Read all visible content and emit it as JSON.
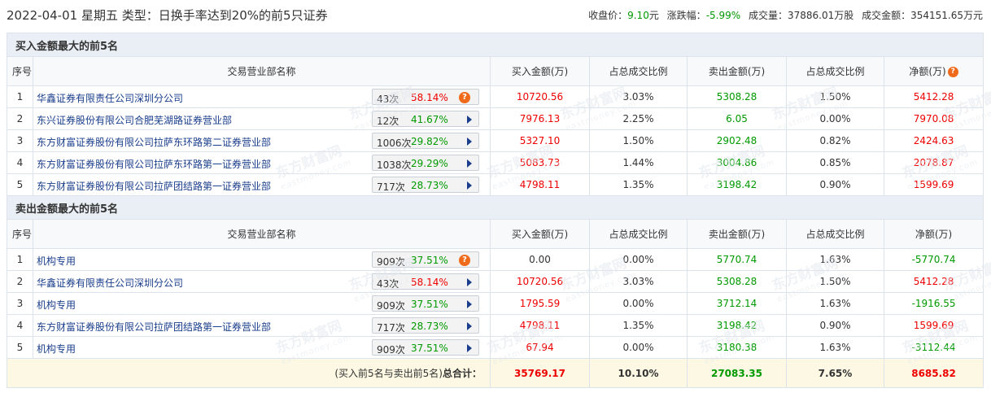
{
  "header": {
    "title": "2022-04-01 星期五 类型：日换手率达到20%的前5只证券",
    "close_label": "收盘价：",
    "close_value": "9.10",
    "close_unit": "元",
    "change_label": "涨跌幅：",
    "change_value": "-5.99%",
    "volume_label": "成交量：",
    "volume_value": "37886.01万股",
    "amount_label": "成交金额：",
    "amount_value": "354151.65万元"
  },
  "buy_section": {
    "title": "买入金额最大的前5名",
    "columns": [
      "序号",
      "交易营业部名称",
      "买入金额(万)",
      "占总成交比例",
      "卖出金额(万)",
      "占总成交比例",
      "净额(万)"
    ],
    "rows": [
      {
        "idx": "1",
        "name": "华鑫证券有限责任公司深圳分公司",
        "count": "43次",
        "pct": "58.14%",
        "pct_color": "red",
        "buy": "10720.56",
        "buy_ratio": "3.03%",
        "sell": "5308.28",
        "sell_ratio": "1.50%",
        "net": "5412.28",
        "net_color": "red",
        "icon": "qmark"
      },
      {
        "idx": "2",
        "name": "东兴证券股份有限公司合肥芜湖路证券营业部",
        "count": "12次",
        "pct": "41.67%",
        "pct_color": "green",
        "buy": "7976.13",
        "buy_ratio": "2.25%",
        "sell": "6.05",
        "sell_ratio": "0.00%",
        "net": "7970.08",
        "net_color": "red",
        "icon": "arrow"
      },
      {
        "idx": "3",
        "name": "东方财富证券股份有限公司拉萨东环路第二证券营业部",
        "count": "1006次",
        "pct": "29.82%",
        "pct_color": "green",
        "buy": "5327.10",
        "buy_ratio": "1.50%",
        "sell": "2902.48",
        "sell_ratio": "0.82%",
        "net": "2424.63",
        "net_color": "red",
        "icon": "arrow"
      },
      {
        "idx": "4",
        "name": "东方财富证券股份有限公司拉萨东环路第一证券营业部",
        "count": "1038次",
        "pct": "29.29%",
        "pct_color": "green",
        "buy": "5083.73",
        "buy_ratio": "1.44%",
        "sell": "3004.86",
        "sell_ratio": "0.85%",
        "net": "2078.87",
        "net_color": "red",
        "icon": "arrow"
      },
      {
        "idx": "5",
        "name": "东方财富证券股份有限公司拉萨团结路第一证券营业部",
        "count": "717次",
        "pct": "28.73%",
        "pct_color": "green",
        "buy": "4798.11",
        "buy_ratio": "1.35%",
        "sell": "3198.42",
        "sell_ratio": "0.90%",
        "net": "1599.69",
        "net_color": "red",
        "icon": "arrow"
      }
    ]
  },
  "sell_section": {
    "title": "卖出金额最大的前5名",
    "columns": [
      "序号",
      "交易营业部名称",
      "买入金额(万)",
      "占总成交比例",
      "卖出金额(万)",
      "占总成交比例",
      "净额(万)"
    ],
    "rows": [
      {
        "idx": "1",
        "name": "机构专用",
        "count": "909次",
        "pct": "37.51%",
        "pct_color": "green",
        "buy": "0.00",
        "buy_color": "plain",
        "buy_ratio": "0.00%",
        "sell": "5770.74",
        "sell_ratio": "1.63%",
        "net": "-5770.74",
        "net_color": "green",
        "icon": "qmark"
      },
      {
        "idx": "2",
        "name": "华鑫证券有限责任公司深圳分公司",
        "count": "43次",
        "pct": "58.14%",
        "pct_color": "red",
        "buy": "10720.56",
        "buy_color": "red",
        "buy_ratio": "3.03%",
        "sell": "5308.28",
        "sell_ratio": "1.50%",
        "net": "5412.28",
        "net_color": "red",
        "icon": "arrow"
      },
      {
        "idx": "3",
        "name": "机构专用",
        "count": "909次",
        "pct": "37.51%",
        "pct_color": "green",
        "buy": "1795.59",
        "buy_color": "red",
        "buy_ratio": "0.00%",
        "sell": "3712.14",
        "sell_ratio": "1.63%",
        "net": "-1916.55",
        "net_color": "green",
        "icon": "arrow"
      },
      {
        "idx": "4",
        "name": "东方财富证券股份有限公司拉萨团结路第一证券营业部",
        "count": "717次",
        "pct": "28.73%",
        "pct_color": "green",
        "buy": "4798.11",
        "buy_color": "red",
        "buy_ratio": "1.35%",
        "sell": "3198.42",
        "sell_ratio": "0.90%",
        "net": "1599.69",
        "net_color": "red",
        "icon": "arrow"
      },
      {
        "idx": "5",
        "name": "机构专用",
        "count": "909次",
        "pct": "37.51%",
        "pct_color": "green",
        "buy": "67.94",
        "buy_color": "red",
        "buy_ratio": "0.00%",
        "sell": "3180.38",
        "sell_ratio": "1.63%",
        "net": "-3112.44",
        "net_color": "green",
        "icon": "arrow"
      }
    ]
  },
  "total": {
    "label_prefix": "(买入前5名与卖出前5名)",
    "label_bold": "总合计：",
    "buy": "35769.17",
    "buy_ratio": "10.10%",
    "sell": "27083.35",
    "sell_ratio": "7.65%",
    "net": "8685.82"
  },
  "watermark": {
    "cn": "东方财富网",
    "en": "eastmoney.com"
  },
  "colors": {
    "up": "#e00",
    "down": "#090",
    "link": "#1a3e8c",
    "section_bg": "#e9eff5",
    "total_bg": "#fcf8e3",
    "icon_orange": "#f06a1b"
  }
}
